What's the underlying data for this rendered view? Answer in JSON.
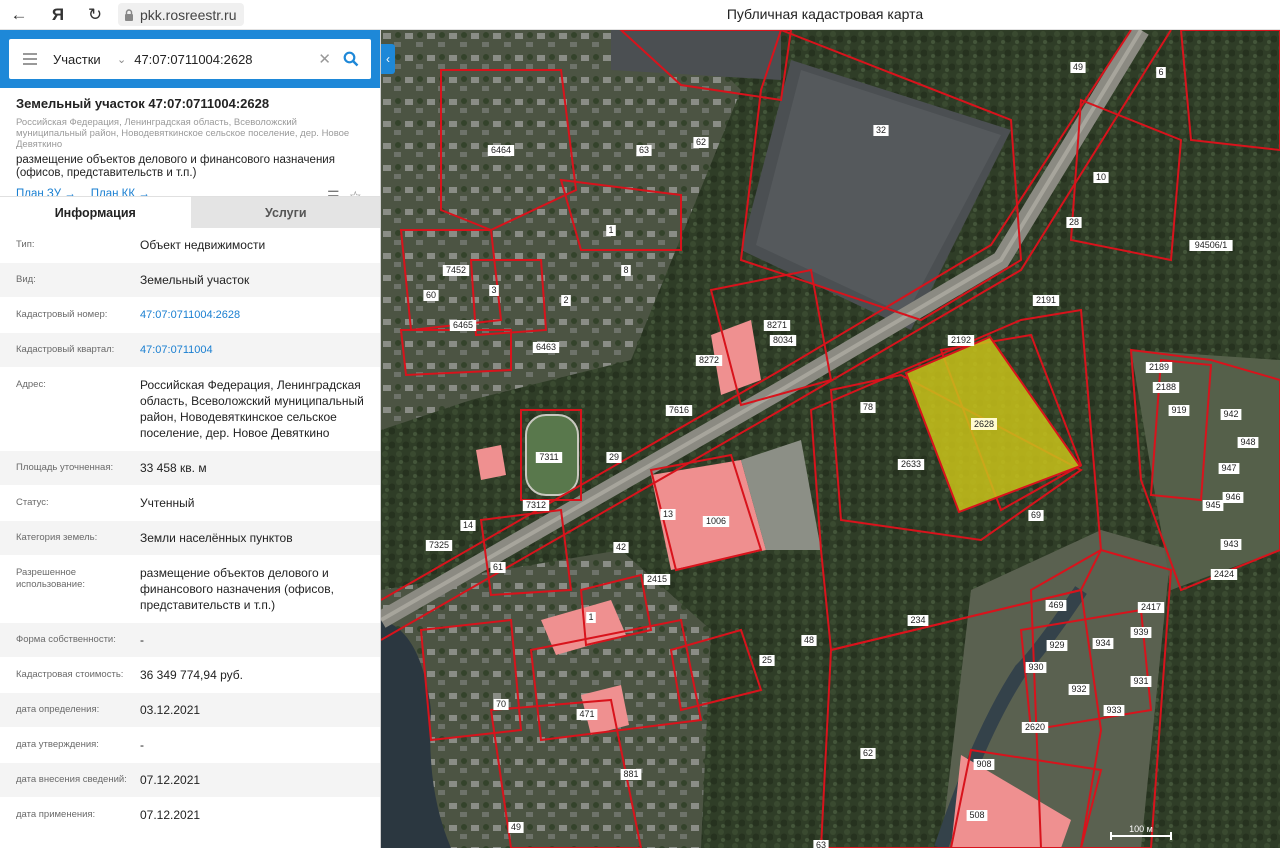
{
  "browser": {
    "url": "pkk.rosreestr.ru",
    "page_title": "Публичная кадастровая карта",
    "yandex_glyph": "Я"
  },
  "search": {
    "type_label": "Участки",
    "query": "47:07:0711004:2628"
  },
  "object": {
    "title": "Земельный участок 47:07:0711004:2628",
    "address_short": "Российская Федерация, Ленинградская область, Всеволожский муниципальный район, Новодевяткинское сельское поселение, дер. Новое Девяткино",
    "purpose": "размещение объектов делового и финансового назначения (офисов, представительств и т.п.)",
    "plan_zu": "План ЗУ →",
    "plan_kk": "План КК →"
  },
  "tabs": [
    {
      "label": "Информация",
      "active": true
    },
    {
      "label": "Услуги",
      "active": false
    }
  ],
  "info_rows": [
    {
      "label": "Тип:",
      "value": "Объект недвижимости"
    },
    {
      "label": "Вид:",
      "value": "Земельный участок"
    },
    {
      "label": "Кадастровый номер:",
      "value": "47:07:0711004:2628",
      "link": true
    },
    {
      "label": "Кадастровый квартал:",
      "value": "47:07:0711004",
      "link": true
    },
    {
      "label": "Адрес:",
      "value": "Российская Федерация, Ленинградская область, Всеволожский муниципальный район, Новодевяткинское сельское поселение, дер. Новое Девяткино"
    },
    {
      "label": "Площадь уточненная:",
      "value": "33 458 кв. м"
    },
    {
      "label": "Статус:",
      "value": "Учтенный"
    },
    {
      "label": "Категория земель:",
      "value": "Земли населённых пунктов"
    },
    {
      "label": "Разрешенное использование:",
      "value": "размещение объектов делового и финансового назначения (офисов, представительств и т.п.)"
    },
    {
      "label": "Форма собственности:",
      "value": "-"
    },
    {
      "label": "Кадастровая стоимость:",
      "value": "36 349 774,94 руб."
    },
    {
      "label": "дата определения:",
      "value": "03.12.2021"
    },
    {
      "label": "дата утверждения:",
      "value": "-"
    },
    {
      "label": "дата внесения сведений:",
      "value": "07.12.2021"
    },
    {
      "label": "дата применения:",
      "value": "07.12.2021"
    }
  ],
  "map": {
    "highlight_label": "2628",
    "scale_label": "100 м",
    "highlight_color": "#c9c21a",
    "boundary_color": "#d8131c",
    "parcel_labels": [
      "32",
      "6",
      "49",
      "10",
      "28",
      "94506/1",
      "2191",
      "2192",
      "6464",
      "63",
      "62",
      "1",
      "8",
      "7452",
      "3",
      "2",
      "60",
      "6465",
      "6463",
      "8271",
      "8034",
      "8272",
      "7616",
      "78",
      "2633",
      "69",
      "7311",
      "29",
      "7312",
      "13",
      "1006",
      "14",
      "7325",
      "42",
      "2415",
      "61",
      "1",
      "48",
      "25",
      "234",
      "62",
      "471",
      "881",
      "70",
      "49",
      "63",
      "469",
      "929",
      "930",
      "932",
      "2620",
      "908",
      "508",
      "2189",
      "2188",
      "919",
      "942",
      "948",
      "947",
      "946",
      "945",
      "943",
      "2424",
      "2417",
      "939",
      "934",
      "931",
      "933"
    ]
  }
}
